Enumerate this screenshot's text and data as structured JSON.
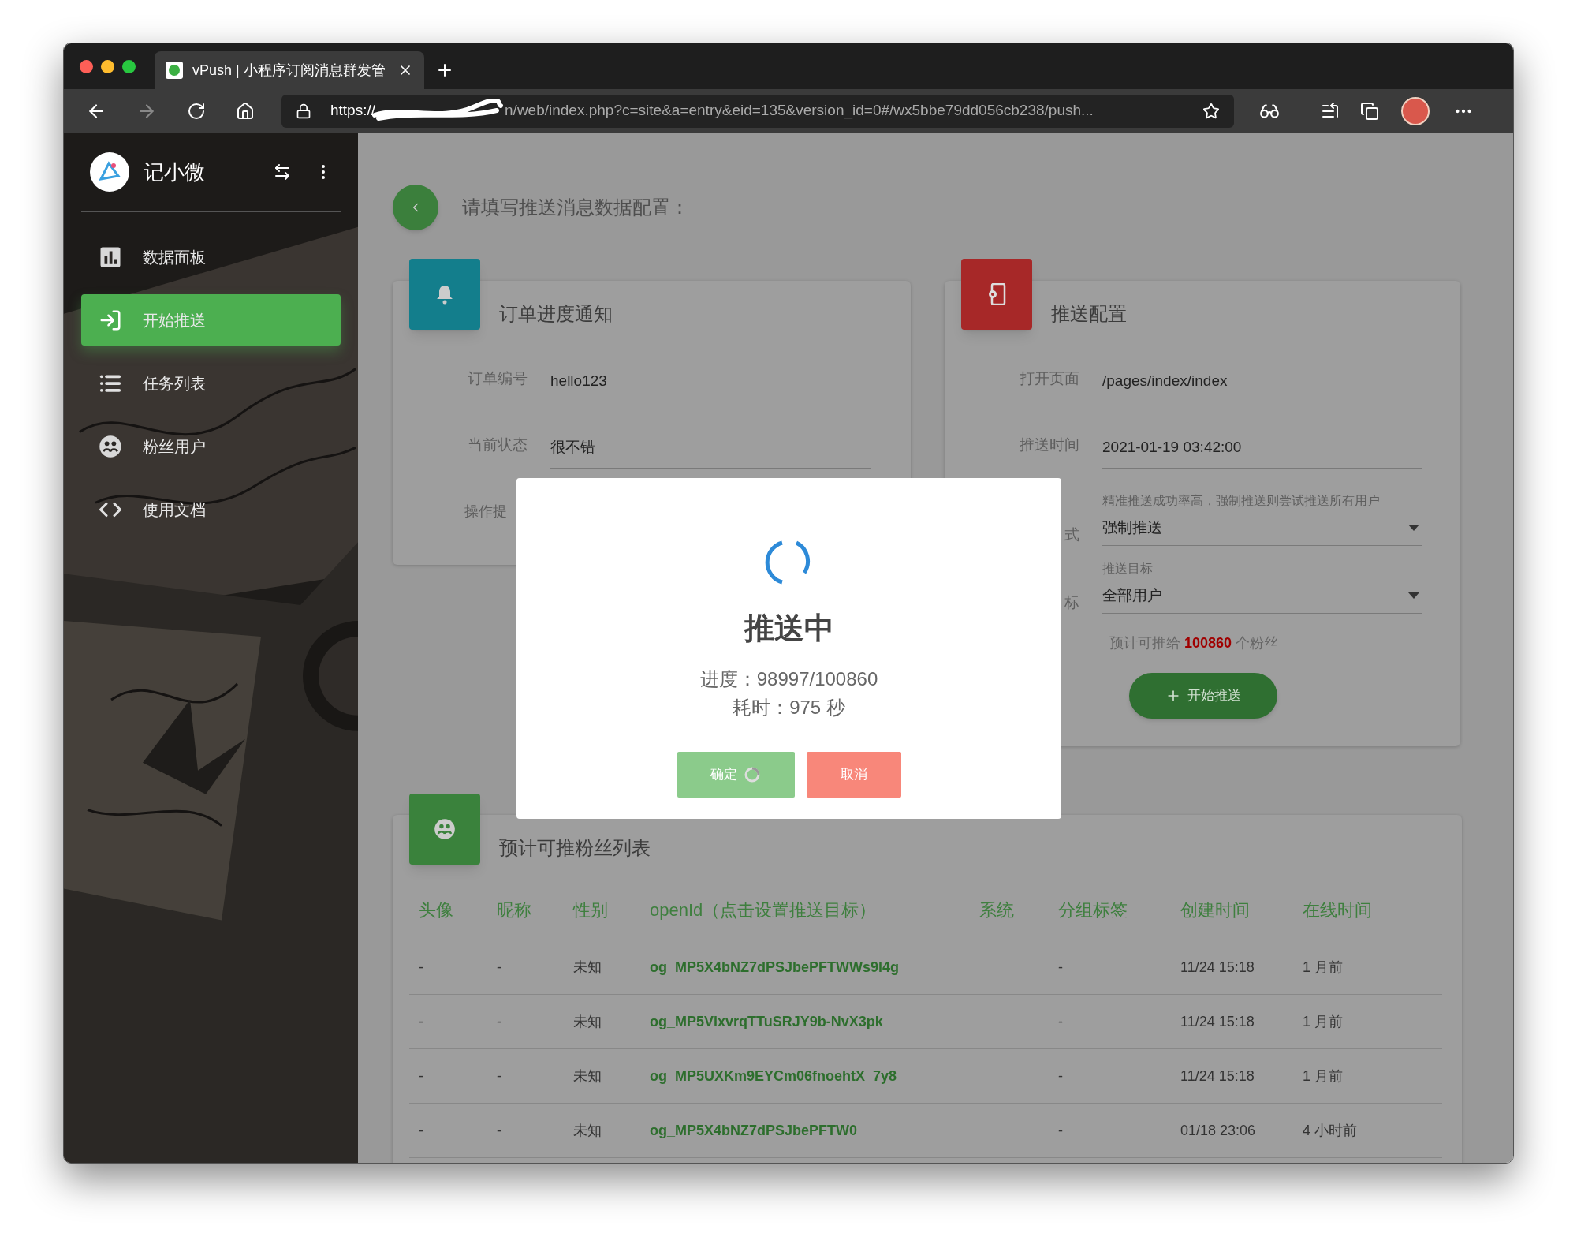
{
  "browser": {
    "tab_title": "vPush | 小程序订阅消息群发管",
    "url_start": "https://",
    "url_rest": "n/web/index.php?c=site&a=entry&eid=135&version_id=0#/wx5bbe79dd056cb238/push..."
  },
  "sidebar": {
    "brand": "记小微",
    "items": [
      {
        "label": "数据面板",
        "selected": false
      },
      {
        "label": "开始推送",
        "selected": true
      },
      {
        "label": "任务列表",
        "selected": false
      },
      {
        "label": "粉丝用户",
        "selected": false
      },
      {
        "label": "使用文档",
        "selected": false
      }
    ]
  },
  "page_title": "请填写推送消息数据配置：",
  "order_card": {
    "title": "订单进度通知",
    "fields": [
      {
        "kind": "text",
        "label": "订单编号",
        "value": "hello123"
      },
      {
        "kind": "text",
        "label": "当前状态",
        "value": "很不错"
      },
      {
        "kind": "label_only",
        "label": "操作提"
      }
    ]
  },
  "push_card": {
    "title": "推送配置",
    "fields": [
      {
        "kind": "text",
        "label": "打开页面",
        "value": "/pages/index/index"
      },
      {
        "kind": "text",
        "label": "推送时间",
        "value": "2021-01-19 03:42:00"
      },
      {
        "kind": "select",
        "label": "式",
        "hint": "精准推送成功率高，强制推送则尝试推送所有用户",
        "value": "强制推送"
      },
      {
        "kind": "select",
        "label": "标",
        "hint": "推送目标",
        "value": "全部用户"
      }
    ],
    "estimate": {
      "prefix": "预计可推给",
      "count": "100860",
      "suffix": "个粉丝"
    },
    "start_button": "开始推送"
  },
  "fans_table": {
    "title": "预计可推粉丝列表",
    "columns": [
      "头像",
      "昵称",
      "性别",
      "openId（点击设置推送目标）",
      "系统",
      "分组标签",
      "创建时间",
      "在线时间"
    ],
    "rows": [
      {
        "avatar": "-",
        "nickname": "-",
        "gender": "未知",
        "openid": "og_MP5X4bNZ7dPSJbePFTWWs9l4g",
        "group": "-",
        "created": "11/24 15:18",
        "online": "1 月前"
      },
      {
        "avatar": "-",
        "nickname": "-",
        "gender": "未知",
        "openid": "og_MP5VlxvrqTTuSRJY9b-NvX3pk",
        "group": "-",
        "created": "11/24 15:18",
        "online": "1 月前"
      },
      {
        "avatar": "-",
        "nickname": "-",
        "gender": "未知",
        "openid": "og_MP5UXKm9EYCm06fnoehtX_7y8",
        "group": "-",
        "created": "11/24 15:18",
        "online": "1 月前"
      },
      {
        "avatar": "-",
        "nickname": "-",
        "gender": "未知",
        "openid": "og_MP5X4bNZ7dPSJbePFTW0",
        "group": "-",
        "created": "01/18 23:06",
        "online": "4 小时前"
      }
    ]
  },
  "modal": {
    "title": "推送中",
    "lines": [
      "进度：98997/100860",
      "耗时：975 秒"
    ],
    "confirm": "确定",
    "confirm_loading": true,
    "cancel": "取消"
  }
}
